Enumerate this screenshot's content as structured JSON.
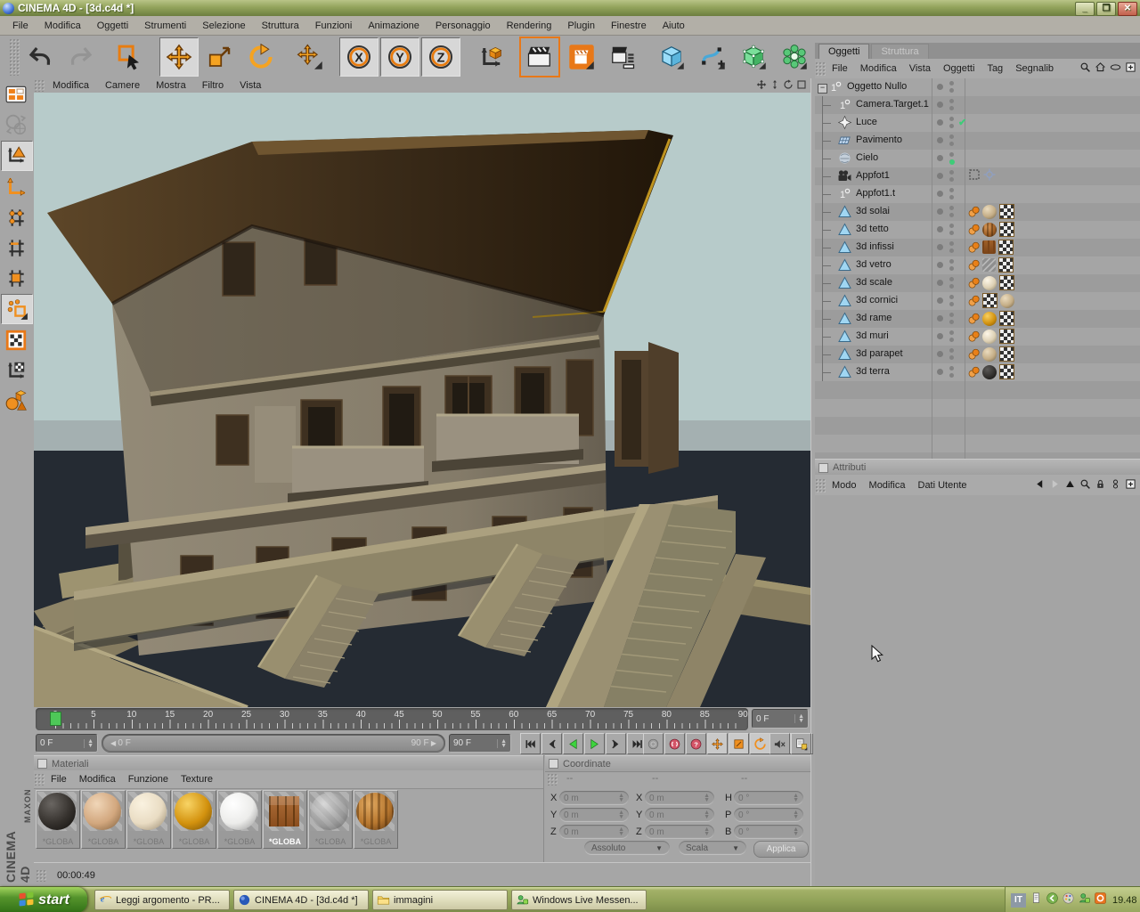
{
  "window": {
    "title": "CINEMA 4D - [3d.c4d *]",
    "controls": [
      "minimize",
      "maximize",
      "close"
    ]
  },
  "menubar": {
    "items": [
      "File",
      "Modifica",
      "Oggetti",
      "Strumenti",
      "Selezione",
      "Struttura",
      "Funzioni",
      "Animazione",
      "Personaggio",
      "Rendering",
      "Plugin",
      "Finestre",
      "Aiuto"
    ]
  },
  "toolbar": {
    "groups": [
      [
        "undo",
        "redo"
      ],
      [
        "live-selection"
      ],
      [
        "move",
        "scale",
        "rotate"
      ],
      [
        "axis-move"
      ],
      [
        "lock-x",
        "lock-y",
        "lock-z"
      ],
      [
        "coordinate-system"
      ],
      [
        "render-view",
        "render-picture-viewer",
        "render-settings"
      ],
      [
        "add-primitive",
        "add-spline",
        "add-nurbs",
        "add-modeling",
        "add-light",
        "add-deformer",
        "add-particles"
      ],
      [
        "help",
        "command-manager",
        "content-browser"
      ]
    ],
    "pressed": [
      "move",
      "lock-x",
      "lock-y",
      "lock-z"
    ],
    "highlighted": [
      "render-view"
    ]
  },
  "left_toolbar": {
    "icons": [
      "convert-editable",
      "world-coordinates",
      "model-tool",
      "object-axis-tool",
      "point-mode",
      "edge-mode",
      "polygon-mode",
      "uvw-mode",
      "texture-mode",
      "texture-axis-mode",
      "snap-primitives"
    ],
    "pressed": [
      "model-tool",
      "uvw-mode"
    ],
    "disabled": [
      "world-coordinates"
    ]
  },
  "viewport": {
    "menu": [
      "Modifica",
      "Camere",
      "Mostra",
      "Filtro",
      "Vista"
    ],
    "nav_icons": [
      "pan",
      "zoom",
      "rotate-view",
      "maximize-view"
    ]
  },
  "object_manager": {
    "tabs": [
      {
        "label": "Oggetti",
        "active": true
      },
      {
        "label": "Struttura",
        "active": false
      }
    ],
    "menu": [
      "File",
      "Modifica",
      "Vista",
      "Oggetti",
      "Tag",
      "Segnalib"
    ],
    "menu_icons": [
      "search",
      "home",
      "eye",
      "add-panel"
    ],
    "objects": [
      {
        "name": "Oggetto Nullo",
        "icon": "null-object",
        "level": 0,
        "expanded": true
      },
      {
        "name": "Camera.Target.1",
        "icon": "null-object",
        "level": 1
      },
      {
        "name": "Luce",
        "icon": "light",
        "level": 1,
        "state": "check"
      },
      {
        "name": "Pavimento",
        "icon": "floor",
        "level": 1
      },
      {
        "name": "Cielo",
        "icon": "sky",
        "level": 1,
        "state": "green-dot"
      },
      {
        "name": "Appfot1",
        "icon": "camera",
        "level": 1,
        "extras": [
          "selection-box",
          "target-crosshair"
        ]
      },
      {
        "name": "Appfot1.t",
        "icon": "null-object",
        "level": 1
      },
      {
        "name": "3d solai",
        "icon": "polygon",
        "level": 1,
        "tags": [
          "phong",
          "mat-beige",
          "uvw"
        ]
      },
      {
        "name": "3d tetto",
        "icon": "polygon",
        "level": 1,
        "tags": [
          "phong",
          "mat-barrel",
          "uvw"
        ]
      },
      {
        "name": "3d infissi",
        "icon": "polygon",
        "level": 1,
        "tags": [
          "phong",
          "mat-crate",
          "uvw"
        ]
      },
      {
        "name": "3d vetro",
        "icon": "polygon",
        "level": 1,
        "tags": [
          "phong",
          "mat-glass",
          "uvw"
        ]
      },
      {
        "name": "3d scale",
        "icon": "polygon",
        "level": 1,
        "tags": [
          "phong",
          "mat-cream",
          "uvw"
        ]
      },
      {
        "name": "3d cornici",
        "icon": "polygon",
        "level": 1,
        "tags": [
          "phong",
          "uvw",
          "mat-beige"
        ]
      },
      {
        "name": "3d rame",
        "icon": "polygon",
        "level": 1,
        "tags": [
          "phong",
          "mat-gold",
          "uvw"
        ]
      },
      {
        "name": "3d muri",
        "icon": "polygon",
        "level": 1,
        "tags": [
          "phong",
          "mat-cream",
          "uvw"
        ]
      },
      {
        "name": "3d parapet",
        "icon": "polygon",
        "level": 1,
        "tags": [
          "phong",
          "mat-beige",
          "uvw"
        ]
      },
      {
        "name": "3d terra",
        "icon": "polygon",
        "level": 1,
        "tags": [
          "phong",
          "mat-dark",
          "uvw"
        ]
      }
    ]
  },
  "attributes_panel": {
    "title": "Attributi",
    "menu": [
      "Modo",
      "Modifica",
      "Dati Utente"
    ],
    "menu_icons": [
      "back",
      "forward",
      "up",
      "search",
      "lock",
      "history",
      "add-panel"
    ]
  },
  "timeline": {
    "tick_labels": [
      "0",
      "5",
      "10",
      "15",
      "20",
      "25",
      "30",
      "35",
      "40",
      "45",
      "50",
      "55",
      "60",
      "65",
      "70",
      "75",
      "80",
      "85",
      "90"
    ],
    "frame_field": "0 F",
    "slider_start": "0 F",
    "slider_end": "90 F",
    "end_frame": "90 F",
    "current_frame": "0 F",
    "transport": [
      "goto-start",
      "prev-key",
      "play-backward",
      "play-forward",
      "next-key",
      "goto-end"
    ],
    "record_buttons": [
      "record-off",
      "record",
      "record-help"
    ],
    "key_toggles": [
      "key-position",
      "key-scale",
      "key-rotation",
      "key-parameter",
      "key-pla"
    ],
    "extra_icons": [
      "sound",
      "snapshot"
    ]
  },
  "materials_panel": {
    "title": "Materiali",
    "menu": [
      "File",
      "Modifica",
      "Funzione",
      "Texture"
    ],
    "items": [
      {
        "label": "*GLOBA",
        "kind": "dark"
      },
      {
        "label": "*GLOBA",
        "kind": "tan"
      },
      {
        "label": "*GLOBA",
        "kind": "cream"
      },
      {
        "label": "*GLOBA",
        "kind": "gold"
      },
      {
        "label": "*GLOBA",
        "kind": "white"
      },
      {
        "label": "*GLOBA",
        "kind": "crate",
        "selected": true
      },
      {
        "label": "*GLOBA",
        "kind": "glass"
      },
      {
        "label": "*GLOBA",
        "kind": "barrel"
      }
    ]
  },
  "coordinates_panel": {
    "title": "Coordinate",
    "column_headers": [
      "--",
      "--",
      "--"
    ],
    "position": {
      "labels": [
        "X",
        "Y",
        "Z"
      ],
      "values": [
        "0 m",
        "0 m",
        "0 m"
      ]
    },
    "size": {
      "labels": [
        "X",
        "Y",
        "Z"
      ],
      "values": [
        "0 m",
        "0 m",
        "0 m"
      ]
    },
    "rotation": {
      "labels": [
        "H",
        "P",
        "B"
      ],
      "values": [
        "0 °",
        "0 °",
        "0 °"
      ]
    },
    "mode_dropdown": "Assoluto",
    "size_dropdown": "Scala",
    "apply_button": "Applica"
  },
  "status_bar": {
    "render_time": "00:00:49"
  },
  "brand": {
    "maxon": "MAXON",
    "cinema": "CINEMA 4D"
  },
  "taskbar": {
    "start_label": "start",
    "tasks": [
      {
        "icon": "internet-explorer",
        "label": "Leggi argomento - PR..."
      },
      {
        "icon": "cinema4d",
        "label": "CINEMA 4D - [3d.c4d *]"
      },
      {
        "icon": "folder",
        "label": "immagini"
      },
      {
        "icon": "messenger",
        "label": "Windows Live Messen..."
      }
    ],
    "tray": {
      "language": "IT",
      "time": "19.48",
      "icons": [
        "tray-doc",
        "tray-collapse",
        "tray-palette",
        "tray-messenger",
        "tray-app"
      ]
    }
  },
  "colors": {
    "accent_orange": "#ef8018",
    "chrome_gray": "#a6a6a6",
    "sky": "#b7cbca",
    "ground": "#252b33",
    "taskbar_olive": "#93a358",
    "play_green": "#3ed43e"
  }
}
